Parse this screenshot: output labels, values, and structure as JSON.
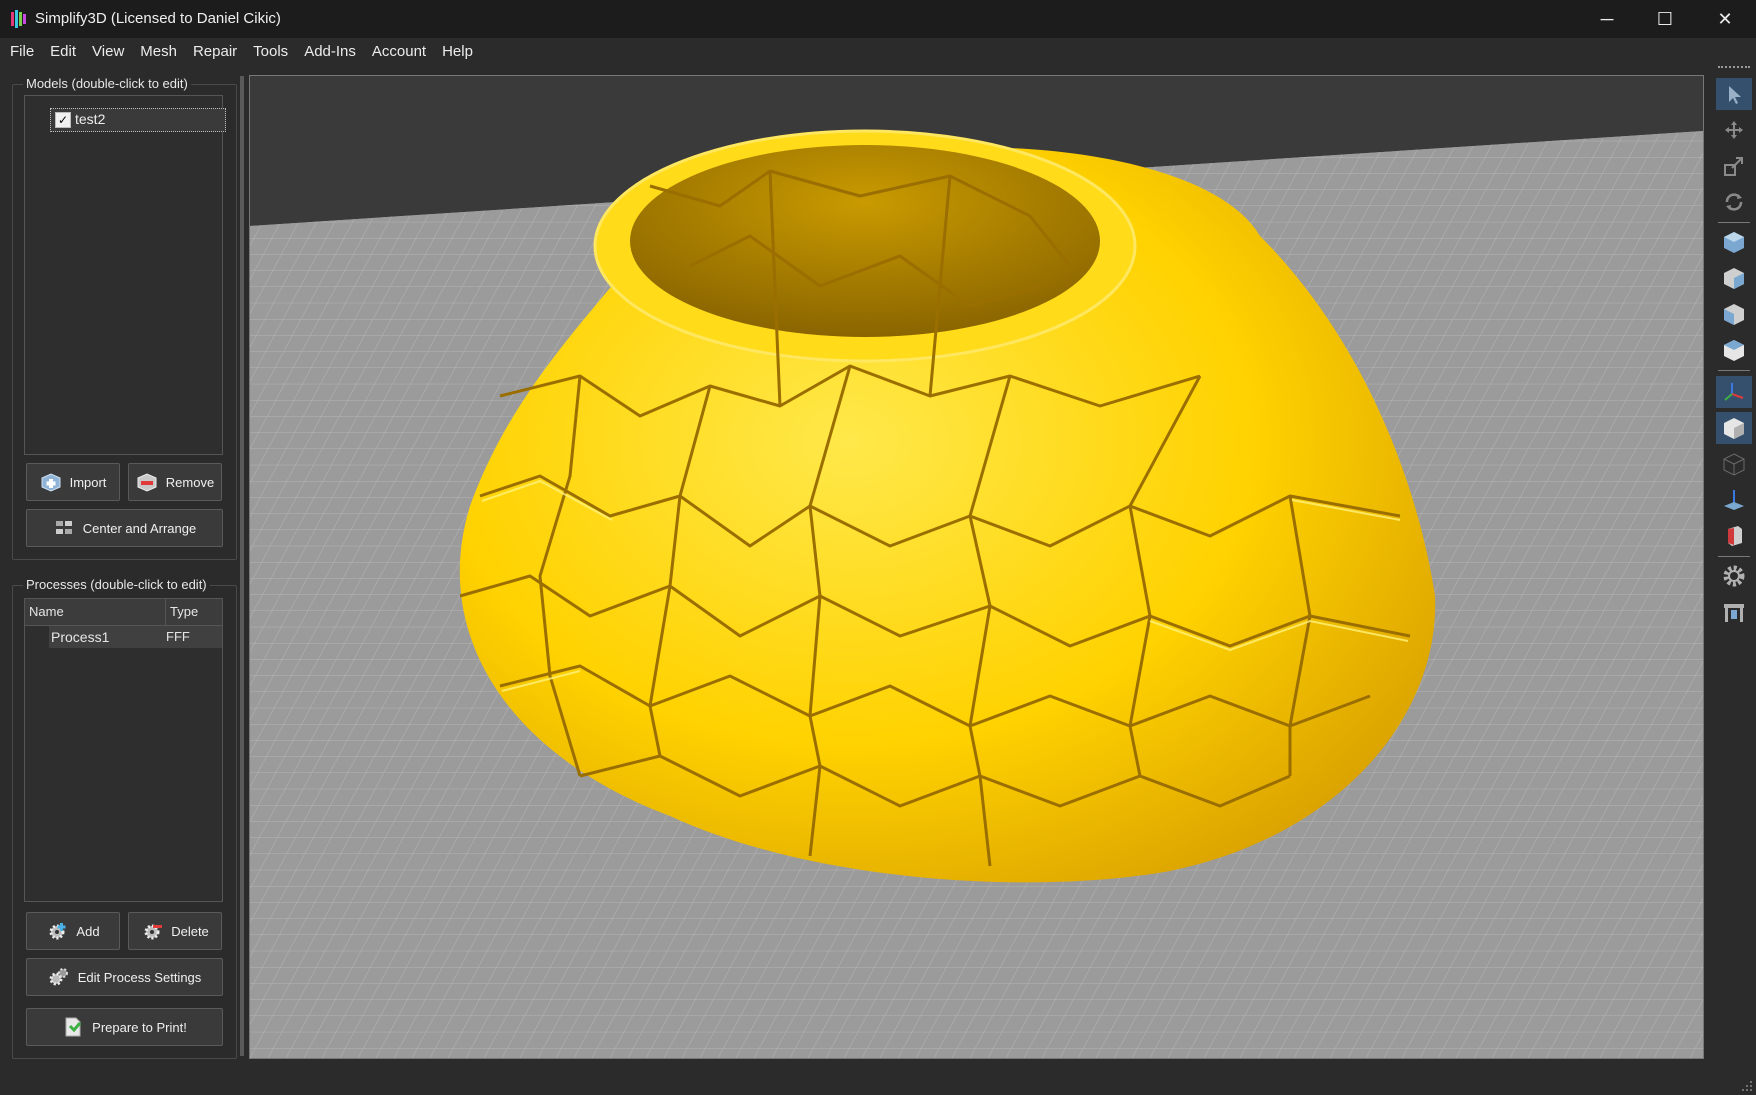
{
  "window": {
    "title": "Simplify3D (Licensed to Daniel Cikic)",
    "minimize_glyph": "─",
    "maximize_glyph": "☐",
    "close_glyph": "✕"
  },
  "menu": [
    "File",
    "Edit",
    "View",
    "Mesh",
    "Repair",
    "Tools",
    "Add-Ins",
    "Account",
    "Help"
  ],
  "models": {
    "group_title": "Models (double-click to edit)",
    "items": [
      {
        "name": "test2",
        "checked": true
      }
    ],
    "check_glyph": "✓",
    "import_label": "Import",
    "remove_label": "Remove",
    "center_label": "Center and Arrange"
  },
  "processes": {
    "group_title": "Processes (double-click to edit)",
    "columns": [
      "Name",
      "Type"
    ],
    "rows": [
      {
        "name": "Process1",
        "type": "FFF"
      }
    ],
    "add_label": "Add",
    "delete_label": "Delete",
    "edit_label": "Edit Process Settings",
    "prepare_label": "Prepare to Print!"
  },
  "viewport": {
    "model_color": "#ffd500",
    "bed_color": "#9b9b9b",
    "background_color": "#3a3a3a"
  },
  "toolbar": {
    "items": [
      "select-arrow-icon",
      "move-icon",
      "scale-icon",
      "rotate-icon",
      "view-default-cube-icon",
      "view-front-cube-icon",
      "view-side-cube-icon",
      "view-top-cube-icon",
      "axes-icon",
      "solid-view-icon",
      "wireframe-view-icon",
      "cross-section-icon",
      "support-icon",
      "settings-gear-icon",
      "printer-icon"
    ]
  }
}
